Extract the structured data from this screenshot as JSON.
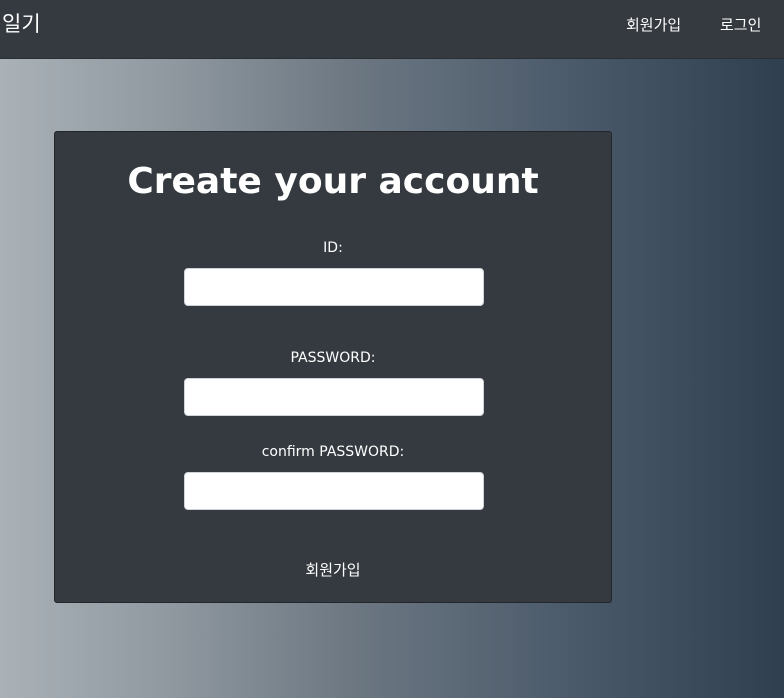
{
  "navbar": {
    "brand": "일기",
    "links": [
      {
        "label": "회원가입"
      },
      {
        "label": "로그인"
      }
    ]
  },
  "form": {
    "title": "Create your account",
    "fields": [
      {
        "label": "ID:",
        "value": "",
        "placeholder": ""
      },
      {
        "label": "PASSWORD:",
        "value": "",
        "placeholder": ""
      },
      {
        "label": "confirm PASSWORD:",
        "value": "",
        "placeholder": ""
      }
    ],
    "submit_label": "회원가입"
  },
  "colors": {
    "navbar_bg": "#343a40",
    "card_bg": "#343a40",
    "text": "#ffffff",
    "input_bg": "#ffffff",
    "gradient_start": "#aab2b8",
    "gradient_end": "#2f3f50"
  }
}
